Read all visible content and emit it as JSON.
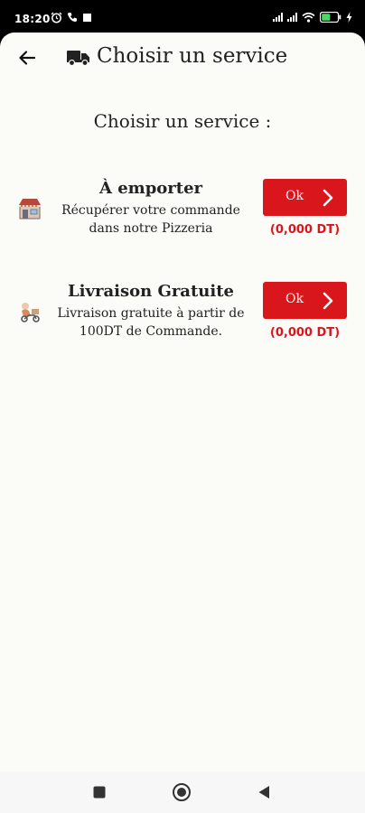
{
  "status_bar": {
    "time": "18:20",
    "battery_level": 0.55,
    "icons": [
      "alarm-icon",
      "phone-icon",
      "stop-icon",
      "signal-icon",
      "signal-icon",
      "wifi-icon",
      "battery-icon",
      "charging-icon"
    ]
  },
  "header": {
    "title": "Choisir un service",
    "back_icon": "arrow-left-icon",
    "title_icon": "truck-icon"
  },
  "section_title": "Choisir un service :",
  "services": [
    {
      "title": "À emporter",
      "description": "Récupérer votre commande dans notre Pizzeria",
      "button_label": "Ok",
      "price": "(0,000 DT)",
      "icon": "store-icon"
    },
    {
      "title": "Livraison Gratuite",
      "description": "Livraison gratuite à partir de 100DT de Commande.",
      "button_label": "Ok",
      "price": "(0,000 DT)",
      "icon": "delivery-icon"
    }
  ],
  "colors": {
    "accent": "#d9161c",
    "background": "#fbfbf7",
    "text": "#222222"
  },
  "nav_bar": {
    "icons": [
      "recents-square-icon",
      "home-circle-icon",
      "back-triangle-icon"
    ]
  }
}
